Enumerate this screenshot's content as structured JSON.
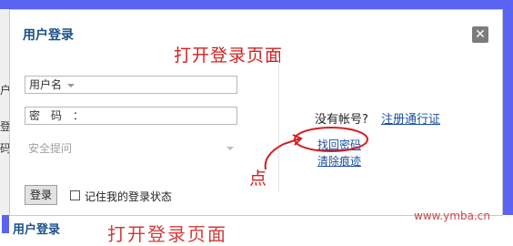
{
  "dialog": {
    "title": "用户登录",
    "close_icon": "close-icon",
    "annotation_title": "打开登录页面",
    "annotation_click": "点"
  },
  "form": {
    "username_label": "用户名",
    "password_label": "密　码　：",
    "security_question": "安全提问",
    "login_button": "登录",
    "remember_label": "记住我的登录状态",
    "remember_checked": false
  },
  "side": {
    "no_account": "没有帐号?",
    "register_link": "注册通行证",
    "find_password": "找回密码",
    "clear_trace": "清除痕迹"
  },
  "background": {
    "peek_title": "用户登录",
    "peek_red": "打开登录页面",
    "left_chars": [
      "户",
      "登",
      "码"
    ]
  },
  "watermark": "www.ymba.cn",
  "colors": {
    "frame": "#5a63f2",
    "annotation": "#d41f1f",
    "link": "#1a4fa0",
    "title": "#1b4f8a"
  }
}
